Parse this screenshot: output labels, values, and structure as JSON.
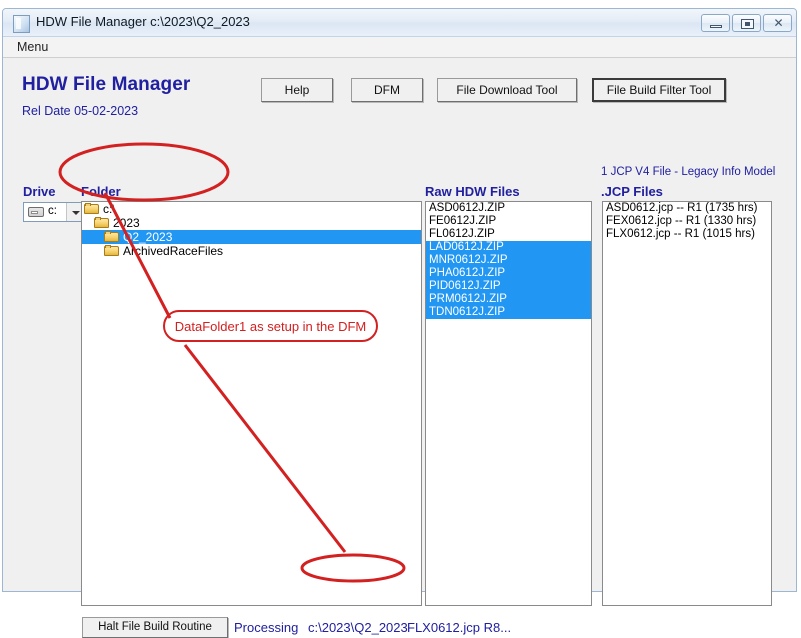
{
  "window": {
    "title": "HDW File Manager c:\\2023\\Q2_2023",
    "icon": "app-icon",
    "controls": {
      "minimize": "minimize-icon",
      "maximize": "maximize-icon",
      "close": "✕"
    }
  },
  "menubar": {
    "items": [
      "Menu"
    ]
  },
  "header": {
    "app_title": "HDW File Manager",
    "rel_date": "Rel Date 05-02-2023"
  },
  "toolbar": {
    "help_label": "Help",
    "dfm_label": "DFM",
    "download_label": "File Download Tool",
    "filter_label": "File Build Filter Tool"
  },
  "drive": {
    "heading": "Drive",
    "icon": "drive-icon",
    "selected": "c:"
  },
  "folder": {
    "heading": "Folder",
    "tree": [
      {
        "label": "c:\\",
        "depth": 0,
        "selected": false
      },
      {
        "label": "2023",
        "depth": 1,
        "selected": false
      },
      {
        "label": "Q2_2023",
        "depth": 2,
        "selected": true
      },
      {
        "label": "ArchivedRaceFiles",
        "depth": 2,
        "selected": false
      }
    ]
  },
  "raw_files": {
    "heading": "Raw HDW Files",
    "items": [
      {
        "name": "ASD0612J.ZIP",
        "selected": false
      },
      {
        "name": "FE0612J.ZIP",
        "selected": false
      },
      {
        "name": "FL0612J.ZIP",
        "selected": false
      },
      {
        "name": "LAD0612J.ZIP",
        "selected": true
      },
      {
        "name": "MNR0612J.ZIP",
        "selected": true
      },
      {
        "name": "PHA0612J.ZIP",
        "selected": true
      },
      {
        "name": "PID0612J.ZIP",
        "selected": true
      },
      {
        "name": "PRM0612J.ZIP",
        "selected": true
      },
      {
        "name": "TDN0612J.ZIP",
        "selected": true
      }
    ]
  },
  "jcp_files": {
    "note": "1 JCP V4 File - Legacy Info Model",
    "heading": ".JCP Files",
    "items": [
      {
        "name": "ASD0612.jcp -- R1 (1735 hrs)",
        "selected": false
      },
      {
        "name": "FEX0612.jcp -- R1 (1330 hrs)",
        "selected": false
      },
      {
        "name": "FLX0612.jcp -- R1 (1015 hrs)",
        "selected": false
      }
    ]
  },
  "statusbar": {
    "halt_label": "Halt File Build Routine",
    "processing_label": "Processing",
    "path": "c:\\2023\\Q2_2023",
    "current_file": "FLX0612.jcp R8..."
  },
  "annotations": {
    "callout_text": "DataFolder1 as setup in the DFM",
    "color": "#d32020"
  }
}
